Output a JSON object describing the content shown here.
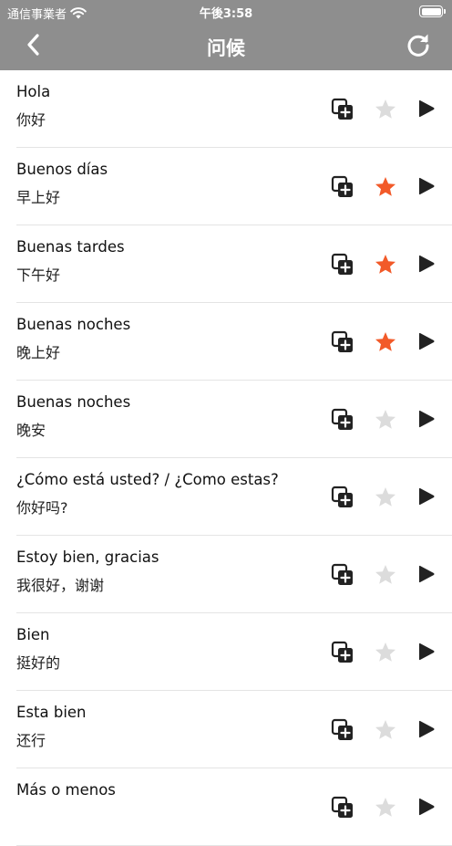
{
  "status_bar": {
    "carrier": "通信事業者",
    "time": "午後3:58"
  },
  "nav": {
    "title": "问候"
  },
  "colors": {
    "header": "#8e8e8e",
    "favorite": "#f25a29",
    "not_favorite": "#dcdcdc",
    "icon": "#222222"
  },
  "items": [
    {
      "phrase": "Hola",
      "translation": "你好",
      "favorite": false
    },
    {
      "phrase": "Buenos días",
      "translation": "早上好",
      "favorite": true
    },
    {
      "phrase": "Buenas tardes",
      "translation": "下午好",
      "favorite": true
    },
    {
      "phrase": "Buenas noches",
      "translation": "晚上好",
      "favorite": true
    },
    {
      "phrase": "Buenas noches",
      "translation": "晚安",
      "favorite": false
    },
    {
      "phrase": "¿Cómo está usted? / ¿Como estas?",
      "translation": "你好吗?",
      "favorite": false
    },
    {
      "phrase": "Estoy bien, gracias",
      "translation": "我很好，谢谢",
      "favorite": false
    },
    {
      "phrase": "Bien",
      "translation": "挺好的",
      "favorite": false
    },
    {
      "phrase": "Esta bien",
      "translation": "还行",
      "favorite": false
    },
    {
      "phrase": "Más o menos",
      "translation": "",
      "favorite": false
    }
  ]
}
